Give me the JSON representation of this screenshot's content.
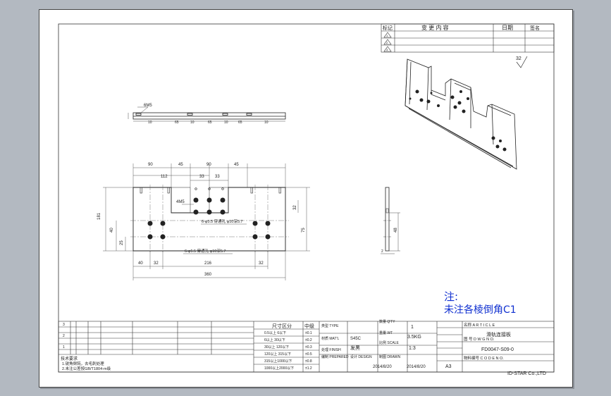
{
  "revision": {
    "headers": [
      "标记",
      "变 更 内 容",
      "日期",
      "签名"
    ],
    "marks": [
      "1",
      "2",
      "3"
    ]
  },
  "roughness": "32",
  "top_view": {
    "callout": "6M5",
    "dims": [
      "10",
      "65",
      "10",
      "65",
      "10",
      "65",
      "10"
    ]
  },
  "front_view": {
    "top_dims": [
      "90",
      "45",
      "90",
      "45"
    ],
    "sub_dims": [
      "112",
      "33",
      "33"
    ],
    "left_dims": [
      "181",
      "40",
      "25"
    ],
    "right_dims": [
      "32",
      "75"
    ],
    "bottom_dims": [
      "40",
      "32",
      "216",
      "32"
    ],
    "overall": "360",
    "hole_label": "4M5",
    "hole_note_1": "6-φ5.5 穿通孔 φ10深5.7",
    "hole_note_2": "6-φ5.5 穿通孔 φ10深5.7"
  },
  "side_view": {
    "dims": [
      "48",
      "2"
    ]
  },
  "note": {
    "title": "注:",
    "text": "未注各棱倒角C1"
  },
  "tolerance": {
    "header_main": "尺寸区分",
    "header_grade": "中级",
    "rows": [
      {
        "range": "0.5以上 6以下",
        "tol": "±0.1"
      },
      {
        "range": "6以上 30以下",
        "tol": "±0.2"
      },
      {
        "range": "30以上 120以下",
        "tol": "±0.3"
      },
      {
        "range": "120以上 315以下",
        "tol": "±0.5"
      },
      {
        "range": "315以上1000以下",
        "tol": "±0.8"
      },
      {
        "range": "1000以上2000以下",
        "tol": "±1.2"
      }
    ]
  },
  "info": {
    "type_label": "类型 TYPE",
    "material_label": "材质 MAT'L",
    "material": "S45C",
    "finish_label": "处理 FINISH",
    "finish": "发黑",
    "prepared_label": "编制 PREPARED",
    "design_label": "设计 DESIGN",
    "date1": "2014/8/20",
    "drawn_label": "制图 DRAWN",
    "date2": "2014/8/20",
    "qty_label": "数量 Q'TY",
    "qty": "1",
    "weight_label": "重量 WT",
    "weight": "3.5KG",
    "scale_label": "比例 SCALE",
    "scale": "1:3",
    "size": "A3"
  },
  "title_block": {
    "article_label": "名称 A R T I C L E",
    "article": "滑轨连接板",
    "dwg_label": "图 号 D W G N O.",
    "dwg_no": "FD0047-S09-0",
    "code_label": "物料编号 C O D E N O."
  },
  "tech_req": {
    "title": "技术要求",
    "items": [
      "1.锐角倒钝，去毛刺处理",
      "2.未注公差按GB/T1804-m级"
    ]
  },
  "company": "ID-STAR Co.,LTD"
}
